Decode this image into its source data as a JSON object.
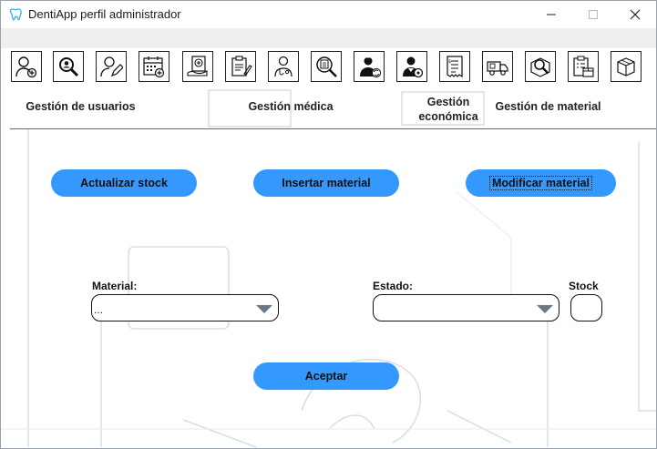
{
  "window": {
    "title": "DentiApp perfil administrador",
    "controls": {
      "minimize": "—",
      "maximize": "☐",
      "close": "✕"
    }
  },
  "toolbar": {
    "icons": [
      "add-user-icon",
      "search-user-icon",
      "edit-user-icon",
      "add-appointment-calendar-icon",
      "medical-record-icon",
      "prescription-icon",
      "doctor-icon",
      "xray-search-icon",
      "swap-staff-icon",
      "staff-settings-icon",
      "invoice-icon",
      "delivery-truck-icon",
      "search-box-icon",
      "inventory-clipboard-icon",
      "package-icon"
    ]
  },
  "sections": {
    "usuarios": "Gestión de usuarios",
    "medica": "Gestión médica",
    "economica_line1": "Gestión",
    "economica_line2": "económica",
    "material": "Gestión de material"
  },
  "actions": {
    "actualizar": "Actualizar stock",
    "insertar": "Insertar material",
    "modificar": "Modificar material"
  },
  "form": {
    "material_label": "Material:",
    "material_value": "...",
    "estado_label": "Estado:",
    "estado_value": "",
    "stock_label": "Stock",
    "submit": "Aceptar"
  },
  "colors": {
    "accent": "#3399ff",
    "divider": "#5a6a86",
    "logo": "#2fb5d8"
  }
}
